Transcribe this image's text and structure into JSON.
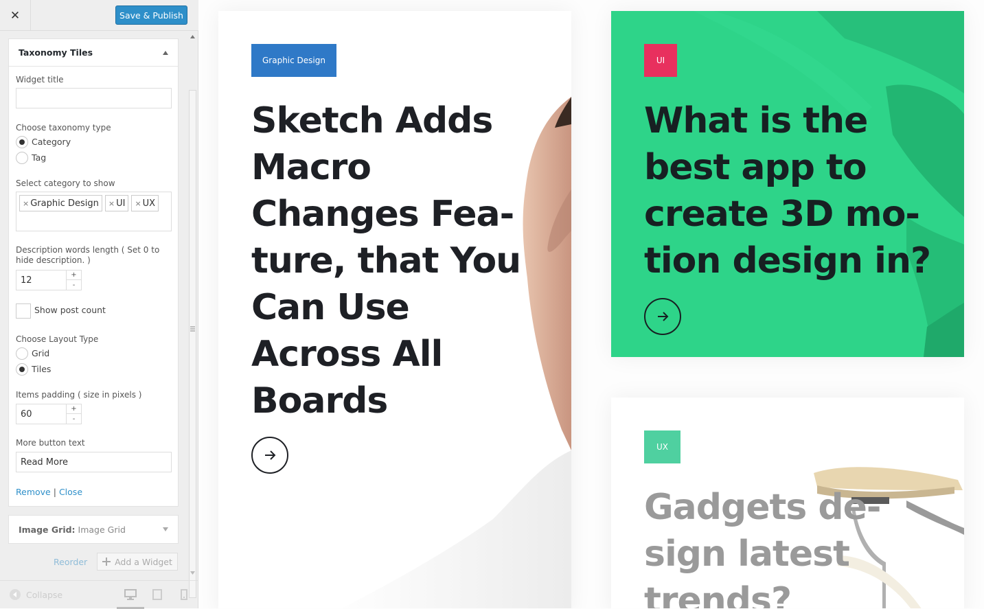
{
  "topbar": {
    "close_glyph": "✕",
    "publish_label": "Save & Publish"
  },
  "widget": {
    "title": "Taxonomy Tiles",
    "widget_title_label": "Widget title",
    "widget_title_value": "",
    "taxonomy_label": "Choose taxonomy type",
    "taxonomy_options": [
      "Category",
      "Tag"
    ],
    "taxonomy_selected": "Category",
    "category_label": "Select category to show",
    "categories": [
      "Graphic Design",
      "UI",
      "UX"
    ],
    "desc_label": "Description words length ( Set 0 to hide description. )",
    "desc_value": "12",
    "show_count_label": "Show post count",
    "layout_label": "Choose Layout Type",
    "layout_options": [
      "Grid",
      "Tiles"
    ],
    "layout_selected": "Tiles",
    "padding_label": "Items padding ( size in pixels )",
    "padding_value": "60",
    "more_label": "More button text",
    "more_value": "Read More",
    "remove_label": "Remove",
    "close_label": "Close"
  },
  "image_grid": {
    "bold": "Image Grid:",
    "rest": "Image Grid"
  },
  "footer": {
    "reorder": "Reorder",
    "add_widget": "Add a Widget",
    "collapse": "Collapse"
  },
  "tiles": [
    {
      "tag": "Graphic Design",
      "tag_color": "#2f79c7",
      "title": [
        "Sketch Adds",
        "Macro",
        "Changes Fea-",
        "ture, that You",
        "Can Use",
        "Across All",
        "Boards"
      ]
    },
    {
      "tag": "UI",
      "tag_color": "#e8305e",
      "bg_color": "#2ed489",
      "title": [
        "What is the",
        "best app to",
        "create 3D mo-",
        "tion design in?"
      ]
    },
    {
      "tag": "UX",
      "tag_color": "#4fd0a0",
      "title": [
        "Gadgets de-",
        "sign latest",
        "trends?"
      ]
    }
  ]
}
